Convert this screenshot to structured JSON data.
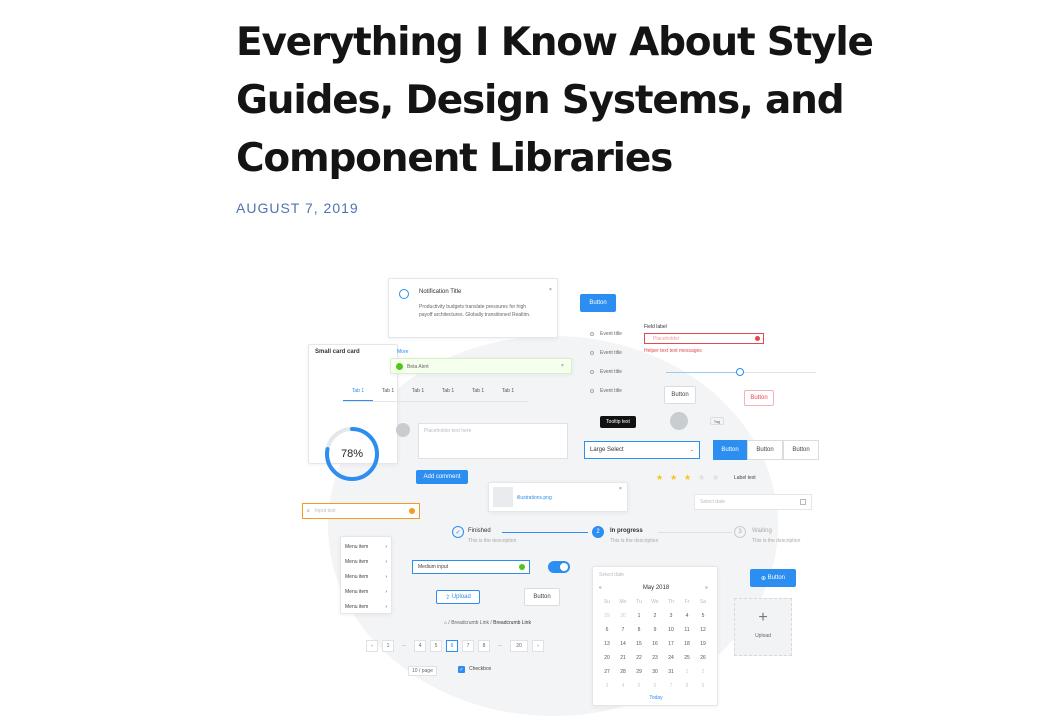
{
  "article": {
    "title_lines": [
      "Everything I Know About Style",
      "Guides, Design Systems, and",
      "Component Libraries"
    ],
    "date": "AUGUST 7, 2019"
  },
  "hero": {
    "notification": {
      "title": "Notification Title",
      "body": "Productivity budgets translate pressures for high payoff architectures. Globally transitioned Realtim."
    },
    "button_label": "Button",
    "card_small": {
      "title": "Small card card",
      "link": "More"
    },
    "alert_text": "Beta Alert",
    "tabs": [
      "Tab 1",
      "Tab 1",
      "Tab 1",
      "Tab 1",
      "Tab 1",
      "Tab 1"
    ],
    "radio_items": [
      "Event title",
      "Event title",
      "Event title",
      "Event title"
    ],
    "field": {
      "label": "Field label",
      "placeholder": "Placeholder",
      "error": "Helper text text messages"
    },
    "tooltip": "Tooltip text",
    "tag": "Tag",
    "progress": {
      "label": "78%",
      "value": 0.78
    },
    "comment_placeholder": "Placeholder text here",
    "add_comment": "Add comment",
    "select_value": "Large Select",
    "button_group": [
      "Button",
      "Button",
      "Button"
    ],
    "rating": {
      "value": 3,
      "max": 5,
      "label": "Label text"
    },
    "upload_file": "illustrations.png",
    "date_input": "Select date",
    "search_placeholder": "Input text",
    "menu_items": [
      "Menu item",
      "Menu item",
      "Menu item",
      "Menu item",
      "Menu item"
    ],
    "steps": [
      {
        "title": "Finished",
        "desc": "This is the description"
      },
      {
        "title": "In progress",
        "desc": "This is the description"
      },
      {
        "title": "Waiting",
        "desc": "This is the description"
      }
    ],
    "medium_input": "Medium input",
    "upload_label": "Upload",
    "upload_box_label": "Upload",
    "calendar": {
      "input": "Select date",
      "month": "May 2018",
      "days": [
        "Su",
        "Mo",
        "Tu",
        "We",
        "Th",
        "Fr",
        "Sa"
      ],
      "dates": [
        "29",
        "30",
        "1",
        "2",
        "3",
        "4",
        "5",
        "6",
        "7",
        "8",
        "9",
        "10",
        "11",
        "12",
        "13",
        "14",
        "15",
        "16",
        "17",
        "18",
        "19",
        "20",
        "21",
        "22",
        "23",
        "24",
        "25",
        "26",
        "27",
        "28",
        "29",
        "30",
        "31",
        "1",
        "2",
        "3",
        "4",
        "5",
        "6",
        "7",
        "8",
        "9"
      ],
      "today": "Today"
    },
    "breadcrumb": [
      "Breadcrumb Link",
      "Breadcrumb Link"
    ],
    "pagination": [
      "1",
      "4",
      "5",
      "6",
      "7",
      "8",
      "20"
    ],
    "page_size": "10 / page",
    "checkbox_label": "Checkbox",
    "colors": {
      "primary": "#2b8ef0",
      "success": "#52c41a",
      "error": "#e5484d",
      "warning": "#f59a23"
    }
  }
}
